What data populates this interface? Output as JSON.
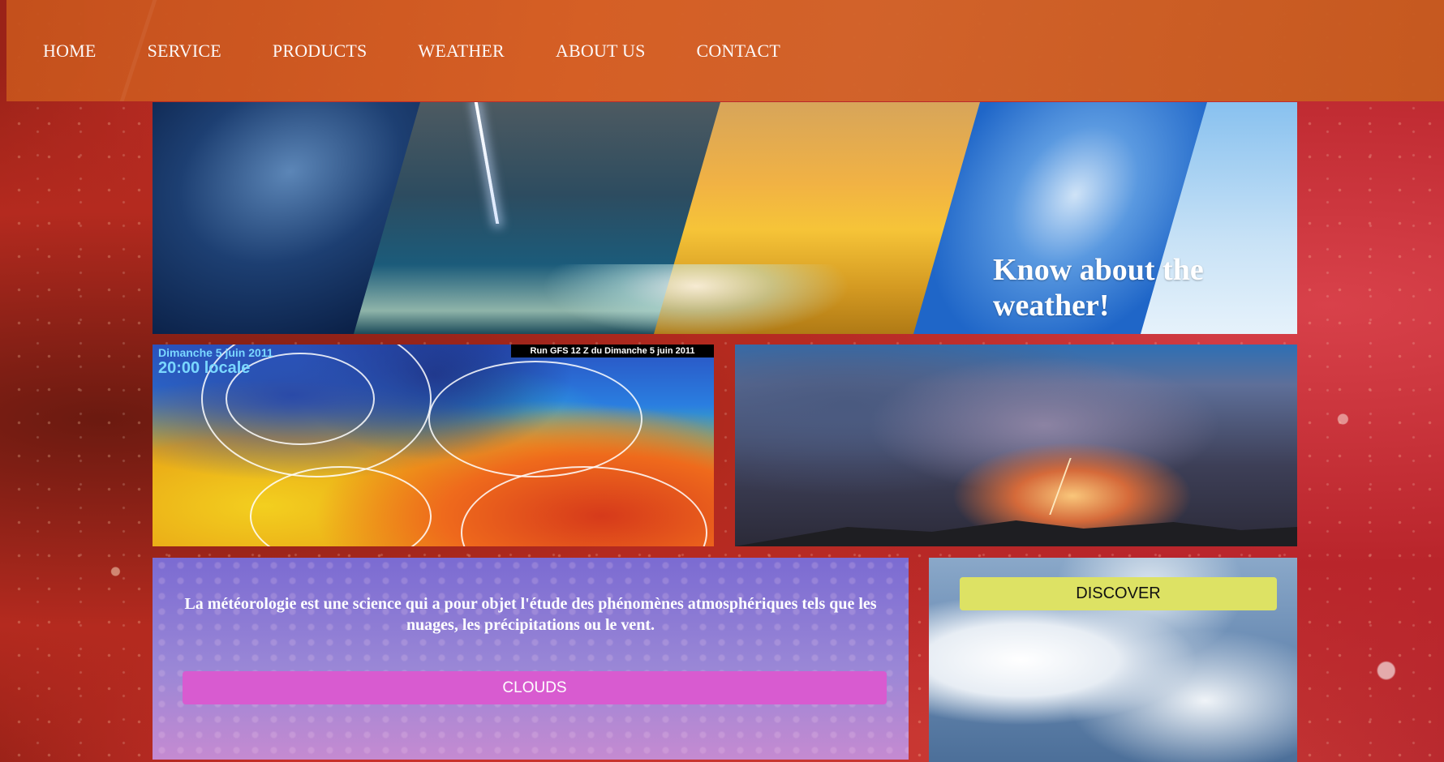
{
  "nav": {
    "items": [
      {
        "label": "HOME"
      },
      {
        "label": "SERVICE"
      },
      {
        "label": "PRODUCTS"
      },
      {
        "label": "WEATHER"
      },
      {
        "label": "ABOUT US"
      },
      {
        "label": "CONTACT"
      }
    ]
  },
  "hero": {
    "title": "Know about the weather!"
  },
  "map": {
    "date": "Dimanche 5 juin 2011",
    "time": "20:00 locale",
    "run_label": "Run GFS 12 Z du Dimanche 5 juin 2011"
  },
  "info": {
    "text": "La météorologie est une science qui a pour objet l'étude des phénomènes atmosphériques tels que les nuages, les précipitations ou le vent.",
    "clouds_button": "CLOUDS"
  },
  "discover": {
    "button": "DISCOVER"
  },
  "colors": {
    "nav_bg": "#d2602a",
    "clouds_button": "#d85bd0",
    "discover_button": "#dde264"
  }
}
